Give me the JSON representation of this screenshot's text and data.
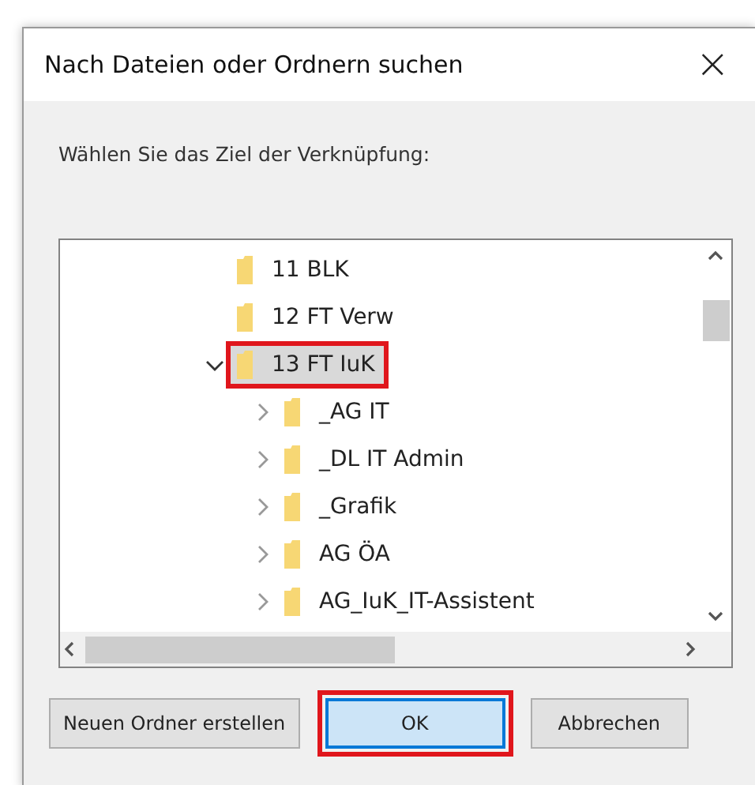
{
  "window": {
    "title": "Nach Dateien oder Ordnern suchen",
    "close": "×"
  },
  "prompt": "Wählen Sie das Ziel der Verknüpfung:",
  "tree": [
    {
      "label": "11 BLK",
      "selected": false,
      "marked": false
    },
    {
      "label": "12 FT Verw",
      "selected": false,
      "marked": false
    },
    {
      "label": "13 FT IuK",
      "selected": true,
      "marked": true,
      "expanded": true,
      "children": [
        {
          "label": "_AG IT",
          "selected": false,
          "marked": false,
          "expanded": false
        },
        {
          "label": "_DL IT Admin",
          "selected": false,
          "marked": false,
          "expanded": false
        },
        {
          "label": "_Grafik",
          "selected": false,
          "marked": false,
          "expanded": false
        },
        {
          "label": "AG ÖA",
          "selected": false,
          "marked": false,
          "expanded": false
        },
        {
          "label": "AG_IuK_IT-Assistent",
          "selected": false,
          "marked": false,
          "expanded": false
        }
      ]
    }
  ],
  "buttons": [
    {
      "label": "Neuen Ordner erstellen",
      "kind": "normal",
      "marked": false
    },
    {
      "label": "OK",
      "kind": "default",
      "marked": true
    },
    {
      "label": "Abbrechen",
      "kind": "normal",
      "marked": false
    }
  ]
}
